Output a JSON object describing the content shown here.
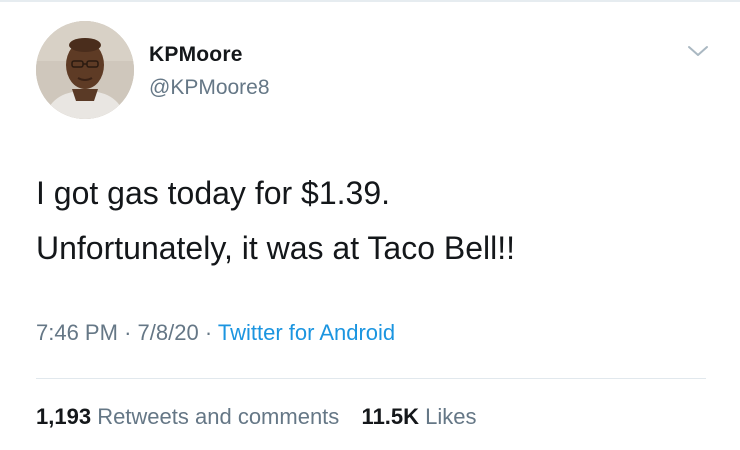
{
  "user": {
    "display_name": "KPMoore",
    "handle": "@KPMoore8",
    "avatar_icon": "profile-photo"
  },
  "menu": {
    "icon": "chevron-down-icon"
  },
  "tweet": {
    "lines": [
      "I got gas today for $1.39.",
      "Unfortunately,  it was at Taco Bell!!"
    ]
  },
  "meta": {
    "time": "7:46 PM",
    "separator": "·",
    "date": "7/8/20",
    "source": "Twitter for Android"
  },
  "stats": {
    "retweets_count": "1,193",
    "retweets_label": "Retweets and comments",
    "likes_count": "11.5K",
    "likes_label": "Likes"
  },
  "colors": {
    "text": "#14171a",
    "secondary": "#657786",
    "link": "#1b95e0",
    "divider": "#e1e8ed"
  }
}
